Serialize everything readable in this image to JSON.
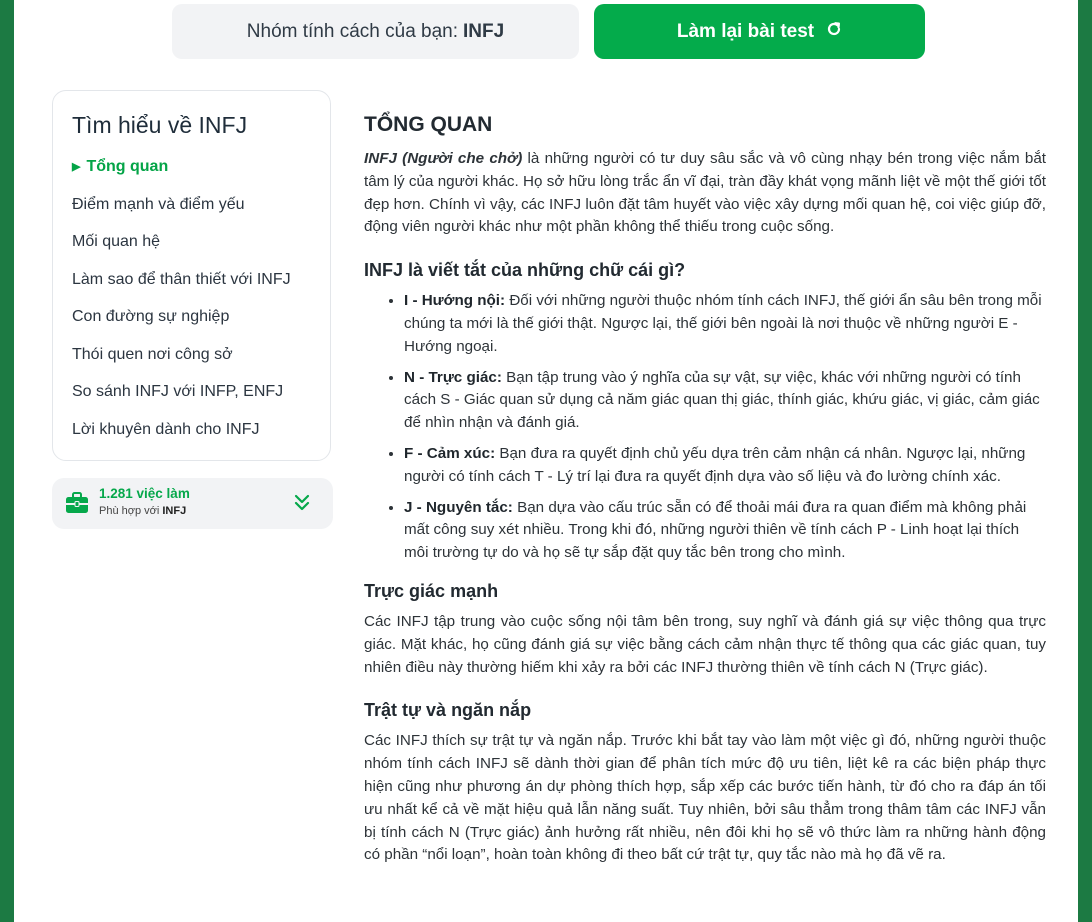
{
  "header": {
    "badge_prefix": "Nhóm tính cách của bạn:",
    "badge_type": "INFJ",
    "retest_label": "Làm lại bài test",
    "retest_icon": "refresh-icon",
    "accent_color": "#04ab4b"
  },
  "sidebar": {
    "title": "Tìm hiểu về INFJ",
    "items": [
      {
        "label": "Tổng quan",
        "active": true
      },
      {
        "label": "Điểm mạnh và điểm yếu"
      },
      {
        "label": "Mối quan hệ"
      },
      {
        "label": "Làm sao để thân thiết với INFJ"
      },
      {
        "label": "Con đường sự nghiệp"
      },
      {
        "label": "Thói quen nơi công sở"
      },
      {
        "label": "So sánh INFJ với INFP, ENFJ"
      },
      {
        "label": "Lời khuyên dành cho INFJ"
      }
    ]
  },
  "jobs": {
    "count": "1.281 việc làm",
    "sub_prefix": "Phù hợp với",
    "sub_type": "INFJ",
    "icon": "briefcase-icon",
    "expand_icon": "chevrons-down-icon"
  },
  "content": {
    "title": "TỔNG QUAN",
    "intro_em": "INFJ (Người che chở)",
    "intro_rest": " là những người có tư duy sâu sắc và vô cùng nhạy bén trong việc nắm bắt tâm lý của người khác. Họ sở hữu lòng trắc ẩn vĩ đại, tràn đầy khát vọng mãnh liệt về một thế giới tốt đẹp hơn. Chính vì vậy, các INFJ luôn đặt tâm huyết vào việc xây dựng mối quan hệ, coi việc giúp đỡ, động viên người khác như một phần không thể thiếu trong cuộc sống.",
    "letters_heading": "INFJ là viết tắt của những chữ cái gì?",
    "letters": [
      {
        "term": "I - Hướng nội:",
        "text": " Đối với những người thuộc nhóm tính cách INFJ, thế giới ẩn sâu bên trong mỗi chúng ta mới là thế giới thật. Ngược lại, thế giới bên ngoài là nơi thuộc về những người E - Hướng ngoại."
      },
      {
        "term": "N - Trực giác:",
        "text": " Bạn tập trung vào ý nghĩa của sự vật, sự việc, khác với những người có tính cách S - Giác quan sử dụng cả năm giác quan thị giác, thính giác, khứu giác, vị giác, cảm giác để nhìn nhận và đánh giá."
      },
      {
        "term": "F - Cảm xúc:",
        "text": " Bạn đưa ra quyết định chủ yếu dựa trên cảm nhận cá nhân. Ngược lại, những người có tính cách T - Lý trí lại đưa ra quyết định dựa vào số liệu và đo lường chính xác."
      },
      {
        "term": "J - Nguyên tắc:",
        "text": " Bạn dựa vào cấu trúc sẵn có để thoải mái đưa ra quan điểm mà không phải mất công suy xét nhiều. Trong khi đó, những người thiên về tính cách P - Linh hoạt lại thích môi trường tự do và họ sẽ tự sắp đặt quy tắc bên trong cho mình."
      }
    ],
    "s1_heading": "Trực giác mạnh",
    "s1_text": "Các INFJ tập trung vào cuộc sống nội tâm bên trong, suy nghĩ và đánh giá sự việc thông qua trực giác. Mặt khác, họ cũng đánh giá sự việc bằng cách cảm nhận thực tế thông qua các giác quan, tuy nhiên điều này thường hiếm khi xảy ra bởi các INFJ thường thiên về tính cách N (Trực giác).",
    "s2_heading": "Trật tự và ngăn nắp",
    "s2_text": "Các INFJ thích sự trật tự và ngăn nắp. Trước khi bắt tay vào làm một việc gì đó, những người thuộc nhóm tính cách INFJ sẽ dành thời gian để phân tích mức độ ưu tiên, liệt kê ra các biện pháp thực hiện cũng như phương án dự phòng thích hợp, sắp xếp các bước tiến hành, từ đó cho ra đáp án tối ưu nhất kể cả về mặt hiệu quả lẫn năng suất. Tuy nhiên, bởi sâu thẳm trong thâm tâm các INFJ vẫn bị tính cách N (Trực giác) ảnh hưởng rất nhiều, nên đôi khi họ sẽ vô thức làm ra những hành động có phần “nổi loạn”, hoàn toàn không đi theo bất cứ trật tự, quy tắc nào mà họ đã vẽ ra."
  }
}
